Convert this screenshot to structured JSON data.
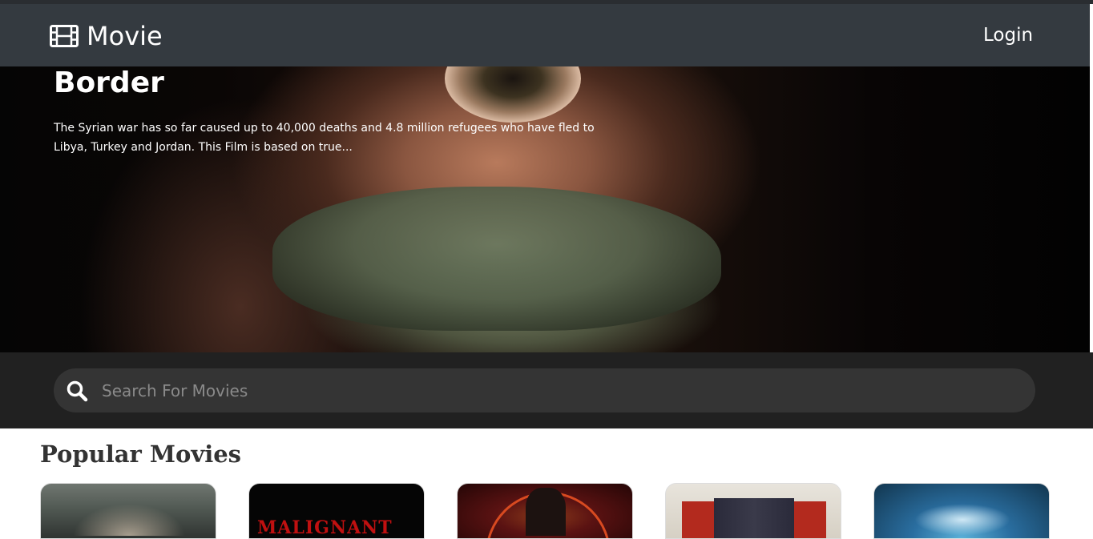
{
  "navbar": {
    "brand": "Movie",
    "brand_icon": "film-icon",
    "login_label": "Login",
    "background": "#343a40"
  },
  "hero": {
    "title": "Border",
    "description": "The Syrian war has so far caused up to 40,000 deaths and 4.8 million refugees who have fled to Libya, Turkey and Jordan. This Film is based on true..."
  },
  "search": {
    "placeholder": "Search For Movies",
    "icon": "search-icon"
  },
  "popular": {
    "title": "Popular Movies",
    "posters": [
      {
        "label": ""
      },
      {
        "label": "MALIGNANT"
      },
      {
        "label": ""
      },
      {
        "label": ""
      },
      {
        "label": ""
      }
    ]
  }
}
